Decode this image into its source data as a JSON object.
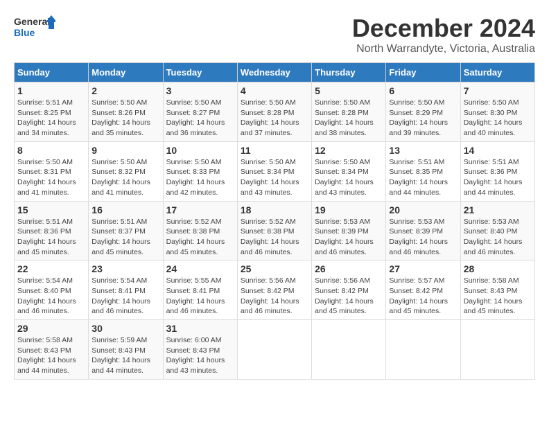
{
  "logo": {
    "line1": "General",
    "line2": "Blue"
  },
  "title": "December 2024",
  "subtitle": "North Warrandyte, Victoria, Australia",
  "days_of_week": [
    "Sunday",
    "Monday",
    "Tuesday",
    "Wednesday",
    "Thursday",
    "Friday",
    "Saturday"
  ],
  "weeks": [
    [
      {
        "day": "1",
        "info": "Sunrise: 5:51 AM\nSunset: 8:25 PM\nDaylight: 14 hours\nand 34 minutes."
      },
      {
        "day": "2",
        "info": "Sunrise: 5:50 AM\nSunset: 8:26 PM\nDaylight: 14 hours\nand 35 minutes."
      },
      {
        "day": "3",
        "info": "Sunrise: 5:50 AM\nSunset: 8:27 PM\nDaylight: 14 hours\nand 36 minutes."
      },
      {
        "day": "4",
        "info": "Sunrise: 5:50 AM\nSunset: 8:28 PM\nDaylight: 14 hours\nand 37 minutes."
      },
      {
        "day": "5",
        "info": "Sunrise: 5:50 AM\nSunset: 8:28 PM\nDaylight: 14 hours\nand 38 minutes."
      },
      {
        "day": "6",
        "info": "Sunrise: 5:50 AM\nSunset: 8:29 PM\nDaylight: 14 hours\nand 39 minutes."
      },
      {
        "day": "7",
        "info": "Sunrise: 5:50 AM\nSunset: 8:30 PM\nDaylight: 14 hours\nand 40 minutes."
      }
    ],
    [
      {
        "day": "8",
        "info": "Sunrise: 5:50 AM\nSunset: 8:31 PM\nDaylight: 14 hours\nand 41 minutes."
      },
      {
        "day": "9",
        "info": "Sunrise: 5:50 AM\nSunset: 8:32 PM\nDaylight: 14 hours\nand 41 minutes."
      },
      {
        "day": "10",
        "info": "Sunrise: 5:50 AM\nSunset: 8:33 PM\nDaylight: 14 hours\nand 42 minutes."
      },
      {
        "day": "11",
        "info": "Sunrise: 5:50 AM\nSunset: 8:34 PM\nDaylight: 14 hours\nand 43 minutes."
      },
      {
        "day": "12",
        "info": "Sunrise: 5:50 AM\nSunset: 8:34 PM\nDaylight: 14 hours\nand 43 minutes."
      },
      {
        "day": "13",
        "info": "Sunrise: 5:51 AM\nSunset: 8:35 PM\nDaylight: 14 hours\nand 44 minutes."
      },
      {
        "day": "14",
        "info": "Sunrise: 5:51 AM\nSunset: 8:36 PM\nDaylight: 14 hours\nand 44 minutes."
      }
    ],
    [
      {
        "day": "15",
        "info": "Sunrise: 5:51 AM\nSunset: 8:36 PM\nDaylight: 14 hours\nand 45 minutes."
      },
      {
        "day": "16",
        "info": "Sunrise: 5:51 AM\nSunset: 8:37 PM\nDaylight: 14 hours\nand 45 minutes."
      },
      {
        "day": "17",
        "info": "Sunrise: 5:52 AM\nSunset: 8:38 PM\nDaylight: 14 hours\nand 45 minutes."
      },
      {
        "day": "18",
        "info": "Sunrise: 5:52 AM\nSunset: 8:38 PM\nDaylight: 14 hours\nand 46 minutes."
      },
      {
        "day": "19",
        "info": "Sunrise: 5:53 AM\nSunset: 8:39 PM\nDaylight: 14 hours\nand 46 minutes."
      },
      {
        "day": "20",
        "info": "Sunrise: 5:53 AM\nSunset: 8:39 PM\nDaylight: 14 hours\nand 46 minutes."
      },
      {
        "day": "21",
        "info": "Sunrise: 5:53 AM\nSunset: 8:40 PM\nDaylight: 14 hours\nand 46 minutes."
      }
    ],
    [
      {
        "day": "22",
        "info": "Sunrise: 5:54 AM\nSunset: 8:40 PM\nDaylight: 14 hours\nand 46 minutes."
      },
      {
        "day": "23",
        "info": "Sunrise: 5:54 AM\nSunset: 8:41 PM\nDaylight: 14 hours\nand 46 minutes."
      },
      {
        "day": "24",
        "info": "Sunrise: 5:55 AM\nSunset: 8:41 PM\nDaylight: 14 hours\nand 46 minutes."
      },
      {
        "day": "25",
        "info": "Sunrise: 5:56 AM\nSunset: 8:42 PM\nDaylight: 14 hours\nand 46 minutes."
      },
      {
        "day": "26",
        "info": "Sunrise: 5:56 AM\nSunset: 8:42 PM\nDaylight: 14 hours\nand 45 minutes."
      },
      {
        "day": "27",
        "info": "Sunrise: 5:57 AM\nSunset: 8:42 PM\nDaylight: 14 hours\nand 45 minutes."
      },
      {
        "day": "28",
        "info": "Sunrise: 5:58 AM\nSunset: 8:43 PM\nDaylight: 14 hours\nand 45 minutes."
      }
    ],
    [
      {
        "day": "29",
        "info": "Sunrise: 5:58 AM\nSunset: 8:43 PM\nDaylight: 14 hours\nand 44 minutes."
      },
      {
        "day": "30",
        "info": "Sunrise: 5:59 AM\nSunset: 8:43 PM\nDaylight: 14 hours\nand 44 minutes."
      },
      {
        "day": "31",
        "info": "Sunrise: 6:00 AM\nSunset: 8:43 PM\nDaylight: 14 hours\nand 43 minutes."
      },
      {
        "day": "",
        "info": ""
      },
      {
        "day": "",
        "info": ""
      },
      {
        "day": "",
        "info": ""
      },
      {
        "day": "",
        "info": ""
      }
    ]
  ]
}
